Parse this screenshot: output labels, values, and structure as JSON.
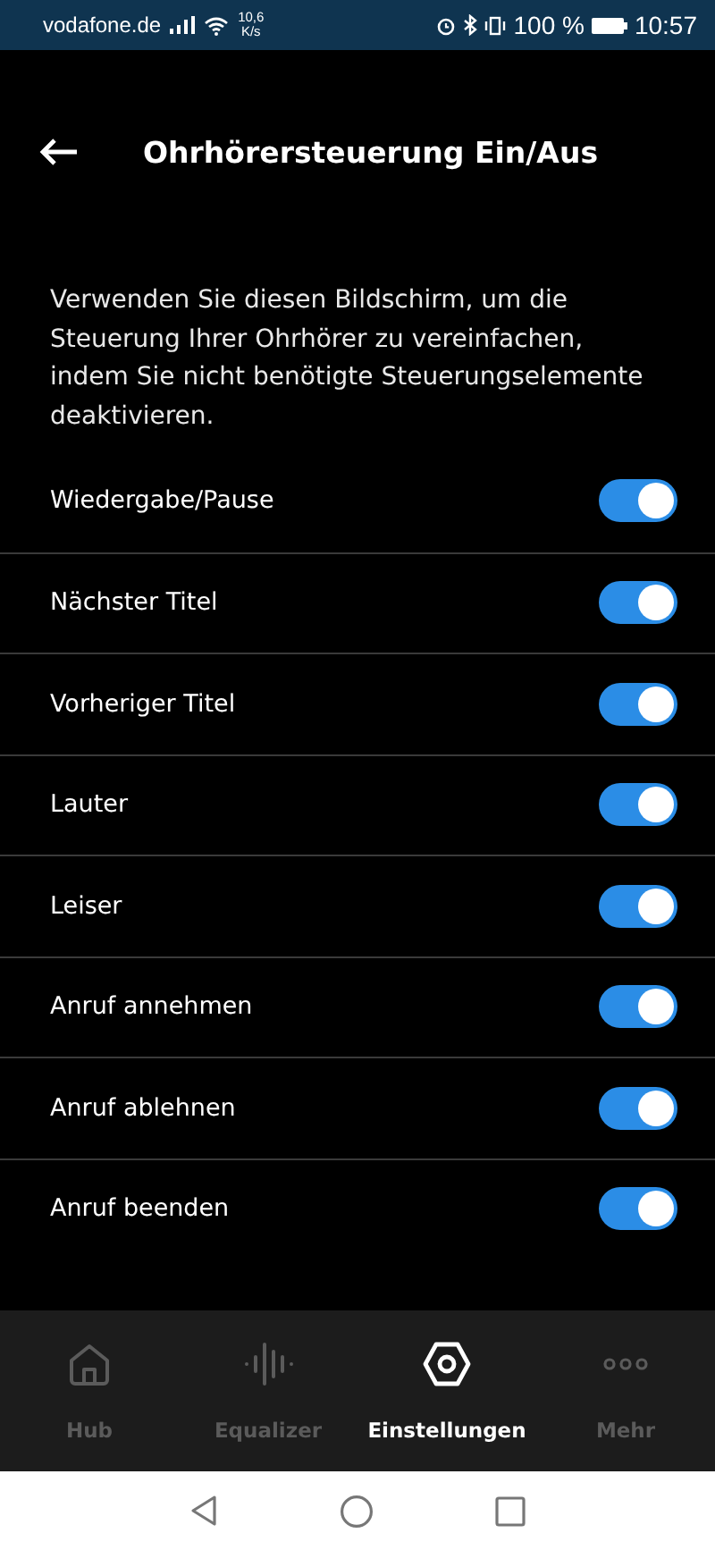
{
  "status_bar": {
    "carrier": "vodafone.de",
    "speed_value": "10,6",
    "speed_unit": "K/s",
    "battery": "100 %",
    "time": "10:57"
  },
  "header": {
    "title": "Ohrhörersteuerung Ein/Aus"
  },
  "description": "Verwenden Sie diesen Bildschirm, um die Steuerung Ihrer Ohrhörer zu vereinfachen, indem Sie nicht benötigte Steuerungselemente deaktivieren.",
  "controls": [
    {
      "label": "Wiedergabe/Pause",
      "on": true
    },
    {
      "label": "Nächster Titel",
      "on": true
    },
    {
      "label": "Vorheriger Titel",
      "on": true
    },
    {
      "label": "Lauter",
      "on": true
    },
    {
      "label": "Leiser",
      "on": true
    },
    {
      "label": "Anruf annehmen",
      "on": true
    },
    {
      "label": "Anruf ablehnen",
      "on": true
    },
    {
      "label": "Anruf beenden",
      "on": true
    }
  ],
  "bottom_nav": [
    {
      "kind": "home",
      "label": "Hub",
      "selected": false
    },
    {
      "kind": "equalizer",
      "label": "Equalizer",
      "selected": false
    },
    {
      "kind": "settings",
      "label": "Einstellungen",
      "selected": true
    },
    {
      "kind": "more",
      "label": "Mehr",
      "selected": false
    }
  ]
}
